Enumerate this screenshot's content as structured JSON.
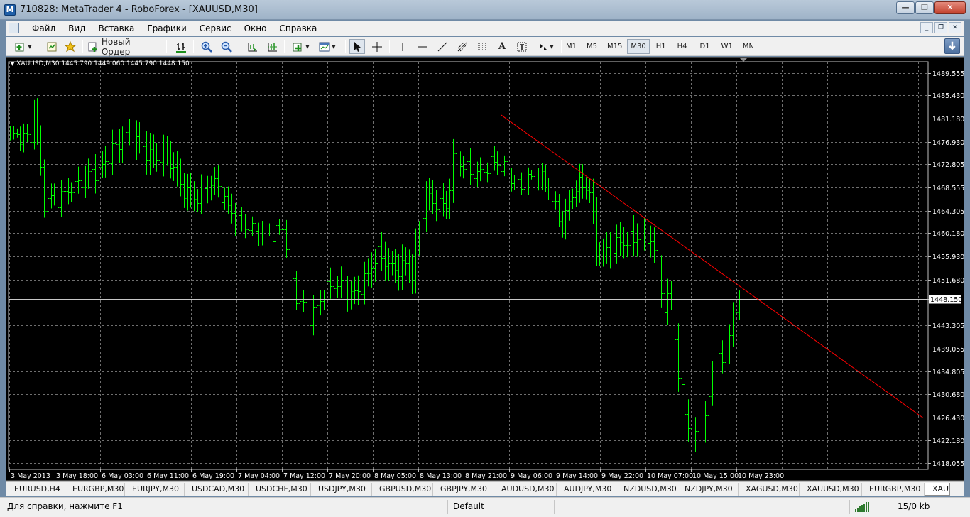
{
  "window": {
    "title": "710828: MetaTrader 4 - RoboForex - [XAUUSD,M30]",
    "minimize": "—",
    "restore": "❐",
    "close": "✕"
  },
  "menu": {
    "items": [
      "Файл",
      "Вид",
      "Вставка",
      "Графики",
      "Сервис",
      "Окно",
      "Справка"
    ]
  },
  "toolbar": {
    "new_order_label": "Новый Ордер",
    "timeframes": [
      "M1",
      "M5",
      "M15",
      "M30",
      "H1",
      "H4",
      "D1",
      "W1",
      "MN"
    ],
    "active_timeframe": "M30",
    "text_tool": "A"
  },
  "chart": {
    "header": "XAUUSD,M30  1445.790 1449.060 1445.790 1448.150",
    "bar_color": "#00ff00",
    "trendline_color": "#ff0000",
    "current_price_label": "1448.150"
  },
  "chart_data": {
    "type": "bar",
    "symbol": "XAUUSD",
    "timeframe": "M30",
    "ylim": [
      1416.9,
      1491.6
    ],
    "y_tick_labels": [
      "1489.555",
      "1485.430",
      "1481.180",
      "1476.930",
      "1472.805",
      "1468.555",
      "1464.305",
      "1460.180",
      "1455.930",
      "1451.680",
      "1448.150",
      "1443.305",
      "1439.055",
      "1434.805",
      "1430.680",
      "1426.430",
      "1422.180",
      "1418.055"
    ],
    "x_tick_labels": [
      "3 May 2013",
      "3 May 18:00",
      "6 May 03:00",
      "6 May 11:00",
      "6 May 19:00",
      "7 May 04:00",
      "7 May 12:00",
      "7 May 20:00",
      "8 May 05:00",
      "8 May 13:00",
      "8 May 21:00",
      "9 May 06:00",
      "9 May 14:00",
      "9 May 22:00",
      "10 May 07:00",
      "10 May 15:00",
      "10 May 23:00"
    ],
    "grid": true,
    "last_price": 1448.15,
    "close_path": [
      [
        0,
        1477.0
      ],
      [
        6,
        1478.5
      ],
      [
        7,
        1484.5
      ],
      [
        8,
        1478.0
      ],
      [
        10,
        1465.5
      ],
      [
        14,
        1466.0
      ],
      [
        18,
        1469.5
      ],
      [
        22,
        1470.0
      ],
      [
        26,
        1471.0
      ],
      [
        30,
        1476.5
      ],
      [
        34,
        1477.5
      ],
      [
        40,
        1475.5
      ],
      [
        46,
        1474.0
      ],
      [
        50,
        1468.5
      ],
      [
        54,
        1467.5
      ],
      [
        60,
        1468.5
      ],
      [
        64,
        1465.5
      ],
      [
        68,
        1462.0
      ],
      [
        72,
        1459.5
      ],
      [
        76,
        1461.0
      ],
      [
        80,
        1461.5
      ],
      [
        84,
        1447.5
      ],
      [
        88,
        1445.5
      ],
      [
        92,
        1449.5
      ],
      [
        96,
        1450.0
      ],
      [
        100,
        1449.5
      ],
      [
        104,
        1451.5
      ],
      [
        108,
        1455.5
      ],
      [
        112,
        1454.5
      ],
      [
        116,
        1454.5
      ],
      [
        118,
        1452.0
      ],
      [
        120,
        1459.5
      ],
      [
        122,
        1467.0
      ],
      [
        126,
        1466.5
      ],
      [
        128,
        1465.0
      ],
      [
        130,
        1472.5
      ],
      [
        134,
        1472.0
      ],
      [
        138,
        1472.0
      ],
      [
        142,
        1472.5
      ],
      [
        146,
        1471.0
      ],
      [
        150,
        1469.5
      ],
      [
        154,
        1470.0
      ],
      [
        158,
        1468.5
      ],
      [
        162,
        1462.5
      ],
      [
        166,
        1468.0
      ],
      [
        170,
        1468.5
      ],
      [
        172,
        1458.0
      ],
      [
        176,
        1456.5
      ],
      [
        180,
        1458.0
      ],
      [
        184,
        1460.5
      ],
      [
        188,
        1459.0
      ],
      [
        190,
        1452.0
      ],
      [
        192,
        1446.0
      ],
      [
        194,
        1449.0
      ],
      [
        196,
        1435.0
      ],
      [
        198,
        1428.5
      ],
      [
        200,
        1421.5
      ],
      [
        204,
        1425.0
      ],
      [
        206,
        1436.0
      ],
      [
        210,
        1439.0
      ],
      [
        214,
        1448.15
      ]
    ],
    "trendline": {
      "from": [
        144,
        1481.9
      ],
      "to": [
        268,
        1426.3
      ]
    }
  },
  "tabs": {
    "items": [
      "EURUSD,H4",
      "EURGBP,M30",
      "EURJPY,M30",
      "USDCAD,M30",
      "USDCHF,M30",
      "USDJPY,M30",
      "GBPUSD,M30",
      "GBPJPY,M30",
      "AUDUSD,M30",
      "AUDJPY,M30",
      "NZDUSD,M30",
      "NZDJPY,M30",
      "XAGUSD,M30",
      "XAUUSD,M30",
      "EURGBP,M30",
      "XAU"
    ],
    "active_index": 15
  },
  "status": {
    "help_text": "Для справки, нажмите F1",
    "profile": "Default",
    "traffic": "15/0 kb"
  }
}
